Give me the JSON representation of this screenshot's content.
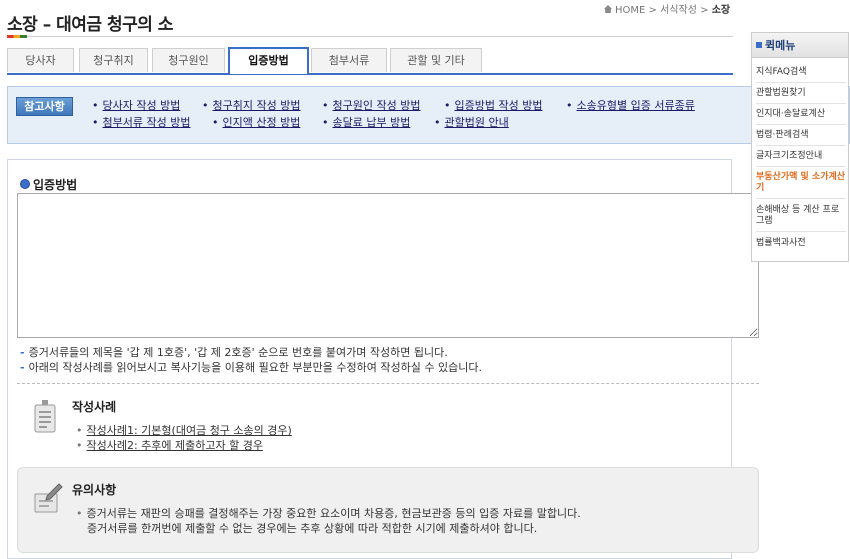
{
  "header": {
    "title": "소장 – 대여금 청구의 소",
    "breadcrumb": {
      "home": "HOME",
      "sep1": ">",
      "mid": "서식작성",
      "sep2": ">",
      "current": "소장"
    }
  },
  "tabs": [
    {
      "label": "당사자"
    },
    {
      "label": "청구취지"
    },
    {
      "label": "청구원인"
    },
    {
      "label": "입증방법",
      "active": true
    },
    {
      "label": "첨부서류"
    },
    {
      "label": "관할 및 기타"
    }
  ],
  "reference": {
    "badge": "참고사항",
    "links": [
      "당사자 작성 방법",
      "청구취지 작성 방법",
      "청구원인 작성 방법",
      "입증방법 작성 방법",
      "소송유형별 입증 서류종류",
      "첨부서류 작성 방법",
      "인지액 산정 방법",
      "송달료 납부 방법",
      "관할법원 안내"
    ]
  },
  "main": {
    "section_title": "입증방법",
    "textarea_value": "",
    "notes": [
      "증거서류들의 제목을 '갑 제 1호증', '갑 제 2호증' 순으로 번호를 붙여가며 작성하면 됩니다.",
      "아래의 작성사례를 읽어보시고 복사기능을 이용해 필요한 부분만을 수정하여 작성하실 수 있습니다."
    ]
  },
  "examples": {
    "title": "작성사례",
    "items": [
      "작성사례1: 기본형(대여금 청구 소송의 경우)",
      "작성사례2: 추후에 제출하고자 할 경우"
    ]
  },
  "caution": {
    "title": "유의사항",
    "line1": "증거서류는 재판의 승패를 결정해주는 가장 중요한 요소이며 차용증, 현금보관증 등의 입증 자료를 말합니다.",
    "line2": "증거서류를 한꺼번에 제출할 수 없는 경우에는 추후 상황에 따라 적합한 시기에 제출하셔야 합니다."
  },
  "quickmenu": {
    "title": "퀵메뉴",
    "items": [
      {
        "label": "지식FAQ검색"
      },
      {
        "label": "관할법원찾기"
      },
      {
        "label": "인지대·송달료계산"
      },
      {
        "label": "법령·판례검색"
      },
      {
        "label": "글자크기조정안내"
      },
      {
        "label": "부동산가액 및 소가계산기",
        "highlight": true
      },
      {
        "label": "손해배상 등 계산 프로그램"
      },
      {
        "label": "법률백과사전"
      }
    ]
  },
  "colors": {
    "accent": "#3a6ec8",
    "highlight": "#e06a1b"
  }
}
